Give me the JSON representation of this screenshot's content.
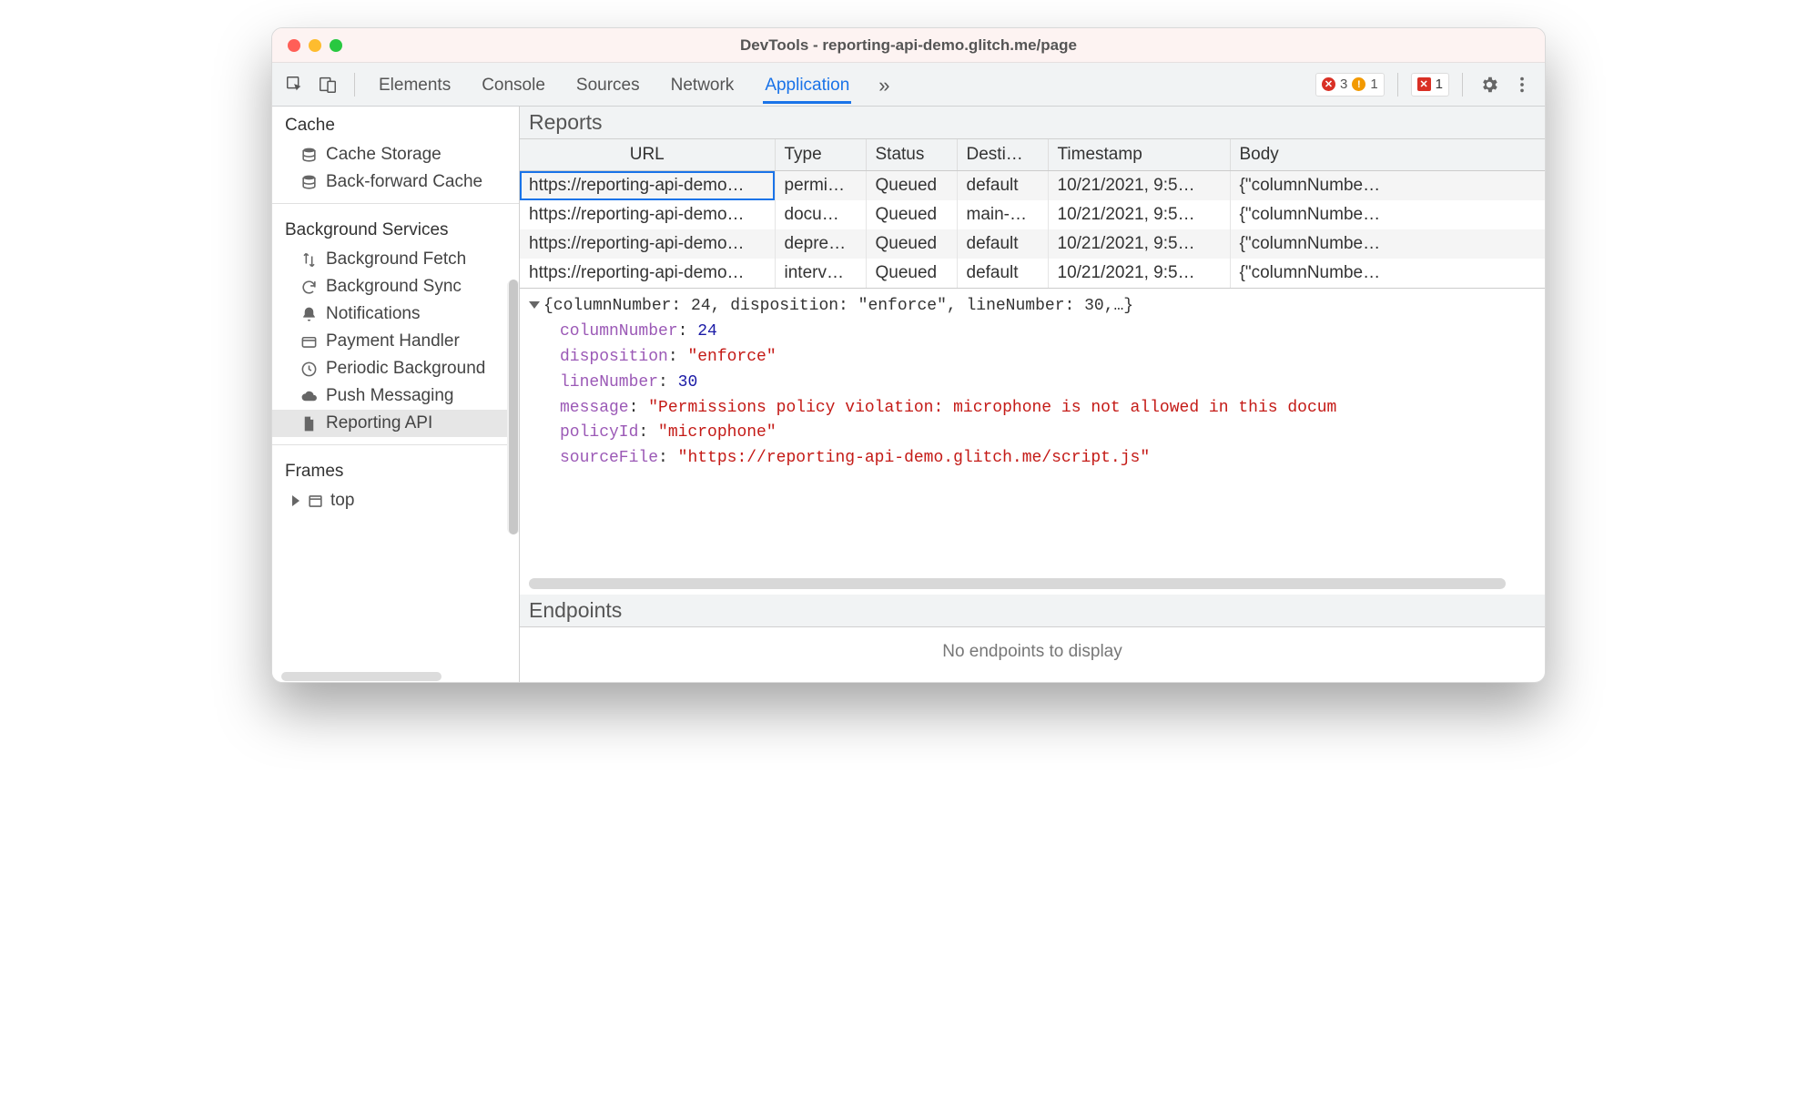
{
  "window": {
    "title": "DevTools - reporting-api-demo.glitch.me/page"
  },
  "toolbar": {
    "tabs": [
      "Elements",
      "Console",
      "Sources",
      "Network",
      "Application"
    ],
    "more": "»",
    "active_tab_index": 4,
    "error_count": "3",
    "warn_count": "1",
    "hidden_error_count": "1"
  },
  "sidebar": {
    "sections": [
      {
        "title": "Cache",
        "items": [
          {
            "icon": "db",
            "label": "Cache Storage"
          },
          {
            "icon": "db",
            "label": "Back-forward Cache"
          }
        ]
      },
      {
        "title": "Background Services",
        "items": [
          {
            "icon": "updown",
            "label": "Background Fetch"
          },
          {
            "icon": "sync",
            "label": "Background Sync"
          },
          {
            "icon": "bell",
            "label": "Notifications"
          },
          {
            "icon": "card",
            "label": "Payment Handler"
          },
          {
            "icon": "clock",
            "label": "Periodic Background"
          },
          {
            "icon": "cloud",
            "label": "Push Messaging"
          },
          {
            "icon": "doc",
            "label": "Reporting API",
            "selected": true
          }
        ]
      },
      {
        "title": "Frames",
        "items": [
          {
            "icon": "frame",
            "label": "top",
            "expandable": true
          }
        ]
      }
    ]
  },
  "reports": {
    "title": "Reports",
    "columns": [
      "URL",
      "Type",
      "Status",
      "Desti…",
      "Timestamp",
      "Body"
    ],
    "rows": [
      {
        "url": "https://reporting-api-demo…",
        "type": "permi…",
        "status": "Queued",
        "dest": "default",
        "ts": "10/21/2021, 9:5…",
        "body": "{\"columnNumbe…",
        "selected": true
      },
      {
        "url": "https://reporting-api-demo…",
        "type": "docu…",
        "status": "Queued",
        "dest": "main-…",
        "ts": "10/21/2021, 9:5…",
        "body": "{\"columnNumbe…"
      },
      {
        "url": "https://reporting-api-demo…",
        "type": "depre…",
        "status": "Queued",
        "dest": "default",
        "ts": "10/21/2021, 9:5…",
        "body": "{\"columnNumbe…"
      },
      {
        "url": "https://reporting-api-demo…",
        "type": "interv…",
        "status": "Queued",
        "dest": "default",
        "ts": "10/21/2021, 9:5…",
        "body": "{\"columnNumbe…"
      }
    ]
  },
  "detail": {
    "summary": "{columnNumber: 24, disposition: \"enforce\", lineNumber: 30,…}",
    "props": [
      {
        "k": "columnNumber",
        "t": "num",
        "v": "24"
      },
      {
        "k": "disposition",
        "t": "str",
        "v": "\"enforce\""
      },
      {
        "k": "lineNumber",
        "t": "num",
        "v": "30"
      },
      {
        "k": "message",
        "t": "str",
        "v": "\"Permissions policy violation: microphone is not allowed in this docum"
      },
      {
        "k": "policyId",
        "t": "str",
        "v": "\"microphone\""
      },
      {
        "k": "sourceFile",
        "t": "str",
        "v": "\"https://reporting-api-demo.glitch.me/script.js\""
      }
    ]
  },
  "endpoints": {
    "title": "Endpoints",
    "empty": "No endpoints to display"
  }
}
